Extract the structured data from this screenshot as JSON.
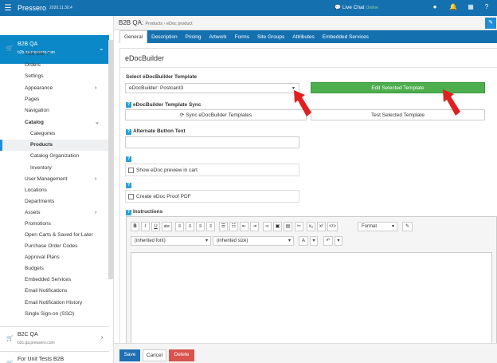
{
  "topbar": {
    "logo": "Pressero",
    "version": "2020.11.30.4",
    "chat_label": "Live Chat",
    "chat_status": "Online",
    "menu_icon": "hamburger-icon"
  },
  "sidebar": {
    "active_site": {
      "name": "B2B QA",
      "url": "b2b.qa.pressero.com"
    },
    "items": [
      {
        "label": "Visit Site"
      },
      {
        "label": "Orders"
      },
      {
        "label": "Settings"
      },
      {
        "label": "Appearance"
      },
      {
        "label": "Pages"
      },
      {
        "label": "Navigation"
      },
      {
        "label": "Catalog"
      },
      {
        "label": "Categories"
      },
      {
        "label": "Products"
      },
      {
        "label": "Catalog Organization"
      },
      {
        "label": "Inventory"
      },
      {
        "label": "User Management"
      },
      {
        "label": "Locations"
      },
      {
        "label": "Departments"
      },
      {
        "label": "Assets"
      },
      {
        "label": "Promotions"
      },
      {
        "label": "Open Carts & Saved for Later"
      },
      {
        "label": "Purchase Order Codes"
      },
      {
        "label": "Approval Plans"
      },
      {
        "label": "Budgets"
      },
      {
        "label": "Embedded Services"
      },
      {
        "label": "Email Notifications"
      },
      {
        "label": "Email Notification History"
      },
      {
        "label": "Single Sign-on (SSO)"
      }
    ],
    "other_sites": [
      {
        "name": "B2C QA",
        "url": "b2c.qa.pressero.com"
      },
      {
        "name": "For Unit Tests B2B",
        "url": ""
      }
    ]
  },
  "header": {
    "title": "B2B QA:",
    "breadcrumb": "Products › eDoc product"
  },
  "tabs": [
    {
      "label": "General"
    },
    {
      "label": "Description"
    },
    {
      "label": "Pricing"
    },
    {
      "label": "Artwork"
    },
    {
      "label": "Forms"
    },
    {
      "label": "Site Groups"
    },
    {
      "label": "Attributes"
    },
    {
      "label": "Embedded Services"
    }
  ],
  "panel": {
    "title": "eDocBuilder",
    "select_label": "Select eDocBuilder Template",
    "select_value": "eDocBuilder: Postcard3",
    "edit_button": "Edit Selected Template",
    "sync_label": "eDocBuilder Template Sync",
    "sync_button": "Sync eDocBuilder Templates",
    "test_button": "Test Selected Template",
    "alt_label": "Alternate Button Text",
    "alt_value": "",
    "show_preview": "Show eDoc preview in cart",
    "proof_pdf": "Create eDoc Proof PDF",
    "instructions_label": "Instructions"
  },
  "editor": {
    "format": "Format",
    "font": "(inherited font)",
    "size": "(inherited size)"
  },
  "actions": {
    "save": "Save",
    "cancel": "Cancel",
    "delete": "Delete"
  },
  "colors": {
    "brand": "#1570b0",
    "active_site": "#0a88c7",
    "green": "#4cae4c",
    "delete": "#d9534f",
    "arrow": "#e02020"
  }
}
